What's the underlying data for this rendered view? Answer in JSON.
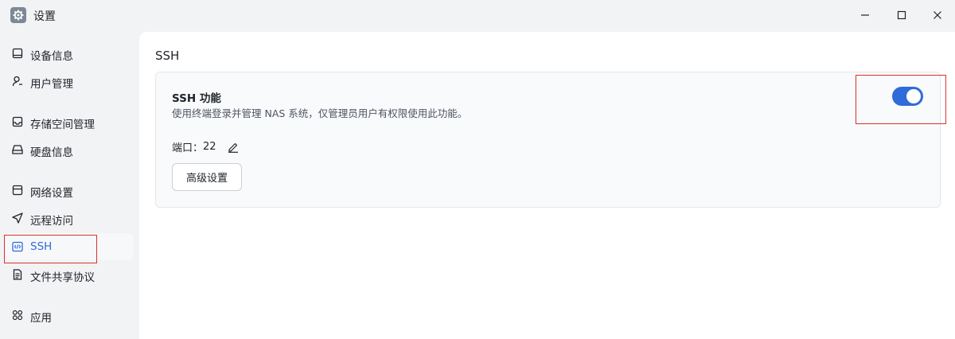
{
  "window": {
    "title": "设置",
    "app_icon": "gear-icon",
    "controls": [
      "minimize-icon",
      "maximize-icon",
      "close-icon"
    ]
  },
  "sidebar": {
    "items": [
      {
        "label": "设备信息",
        "icon": "monitor-icon"
      },
      {
        "label": "用户管理",
        "icon": "user-icon"
      },
      {
        "label": "存储空间管理",
        "icon": "storage-icon"
      },
      {
        "label": "硬盘信息",
        "icon": "disk-icon"
      },
      {
        "label": "网络设置",
        "icon": "network-icon"
      },
      {
        "label": "远程访问",
        "icon": "send-icon"
      },
      {
        "label": "SSH",
        "icon": "code-icon",
        "active": true
      },
      {
        "label": "文件共享协议",
        "icon": "document-icon"
      },
      {
        "label": "应用",
        "icon": "apps-icon"
      }
    ]
  },
  "main": {
    "section_title": "SSH",
    "card": {
      "title": "SSH 功能",
      "description": "使用终端登录并管理 NAS 系统，仅管理员用户有权限使用此功能。",
      "port_label": "端口：",
      "port_value": "22",
      "advanced_button": "高级设置",
      "toggle_on": true
    }
  },
  "colors": {
    "accent": "#2f6bd9",
    "highlight": "#d9322e",
    "sidebar_bg": "#f2f3f5",
    "panel_bg": "#ffffff"
  }
}
